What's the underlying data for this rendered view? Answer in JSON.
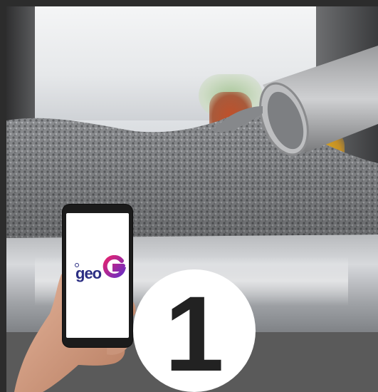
{
  "phone": {
    "logo_text": "geo",
    "logo_letter": "G",
    "logo_colors": {
      "text": "#2b2e83",
      "gradient_start": "#e6226f",
      "gradient_end": "#6a2ec3"
    }
  },
  "step": {
    "number": "1"
  },
  "colors": {
    "bottom_band": "#5a5a5a",
    "circle": "#ffffff",
    "number": "#222222"
  }
}
